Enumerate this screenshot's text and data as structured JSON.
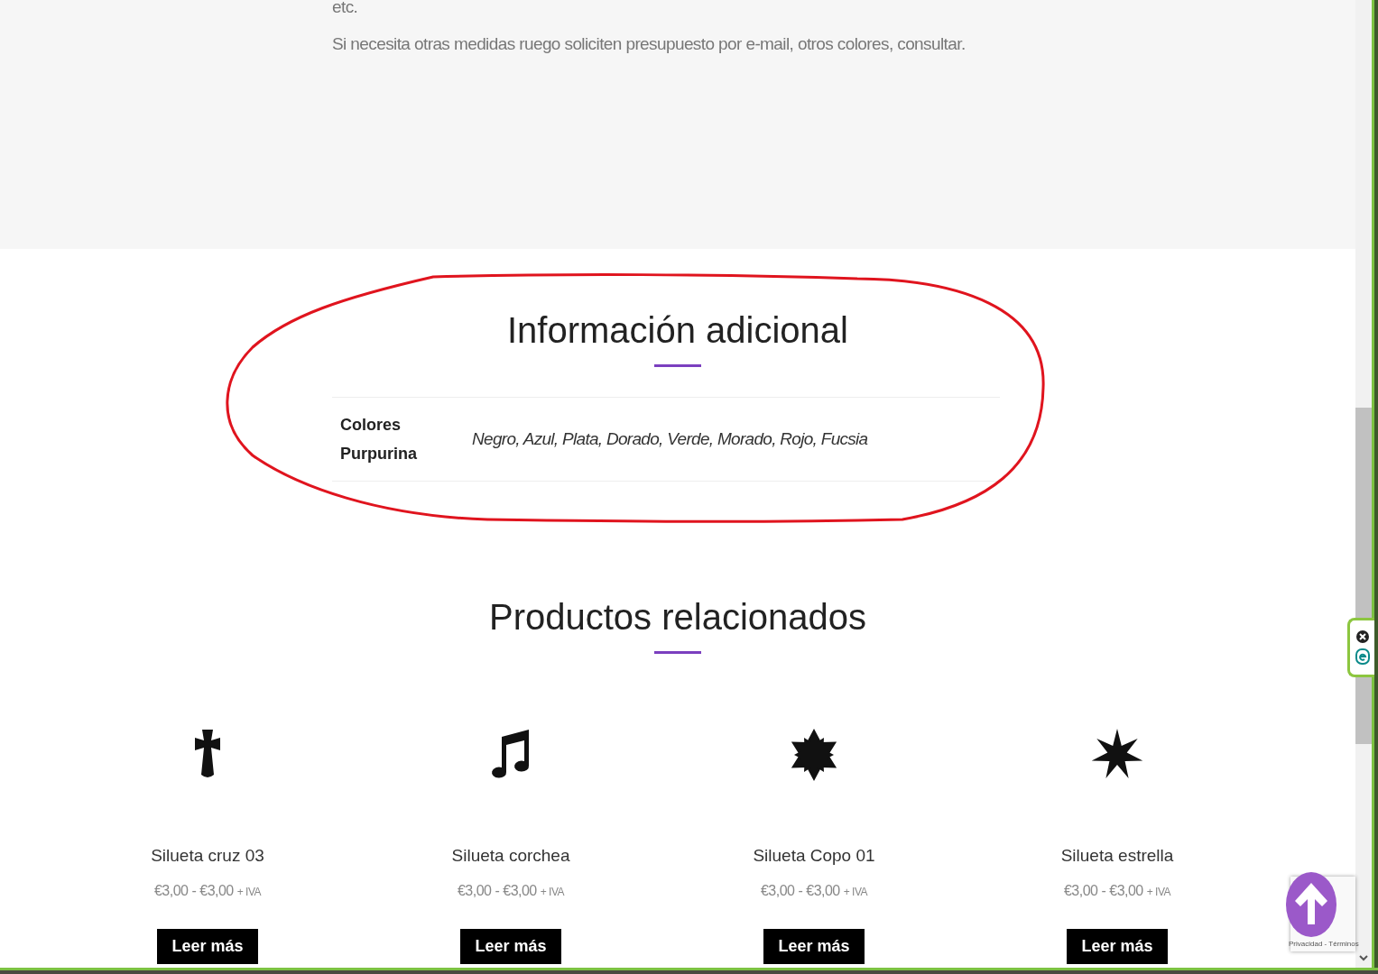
{
  "description": {
    "lines": [
      "etc.",
      "Si necesita otras medidas ruego soliciten presupuesto por e-mail, otros colores, consultar."
    ]
  },
  "additional_info": {
    "title": "Información adicional",
    "attributes": [
      {
        "label": "Colores Purpurina",
        "value": "Negro, Azul, Plata, Dorado, Verde, Morado, Rojo, Fucsia"
      }
    ]
  },
  "related_products": {
    "title": "Productos relacionados",
    "products": [
      {
        "kind": "cross",
        "name": "Silueta cruz 03",
        "price": "€3,00 - €3,00",
        "tax": "+ IVA",
        "button": "Leer más"
      },
      {
        "kind": "note",
        "name": "Silueta corchea",
        "price": "€3,00 - €3,00",
        "tax": "+ IVA",
        "button": "Leer más"
      },
      {
        "kind": "snowflake",
        "name": "Silueta Copo 01",
        "price": "€3,00 - €3,00",
        "tax": "+ IVA",
        "button": "Leer más"
      },
      {
        "kind": "star",
        "name": "Silueta estrella",
        "price": "€3,00 - €3,00",
        "tax": "+ IVA",
        "button": "Leer más"
      }
    ]
  },
  "recaptcha": {
    "text": "Privacidad - Términos"
  }
}
